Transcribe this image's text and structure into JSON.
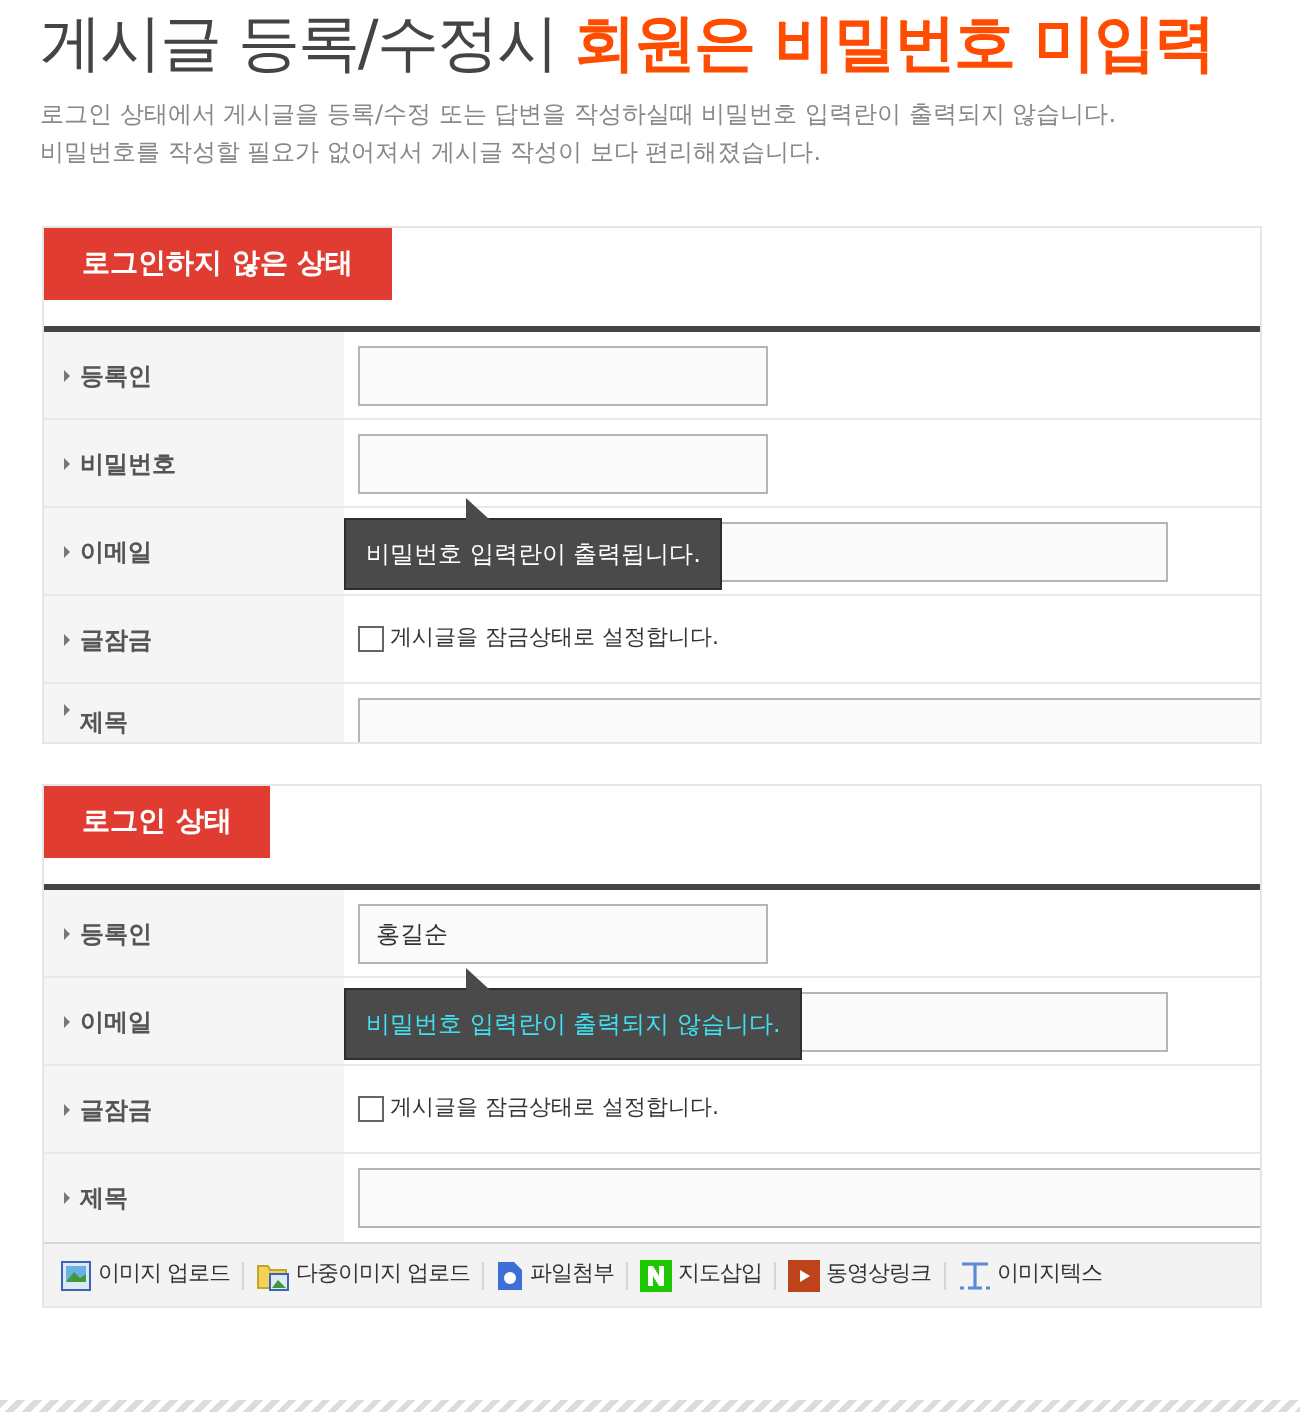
{
  "title": {
    "plain": "게시글 등록/수정시",
    "highlight": "회원은 비밀번호 미입력"
  },
  "description": [
    "로그인 상태에서 게시글을 등록/수정 또는 답변을 작성하실때 비밀번호 입력란이 출력되지 않습니다.",
    "비밀번호를 작성할 필요가 없어져서 게시글 작성이 보다 편리해졌습니다."
  ],
  "panels": [
    {
      "tab": "로그인하지 않은 상태",
      "rows": [
        {
          "kind": "short",
          "label": "등록인"
        },
        {
          "kind": "short",
          "label": "비밀번호",
          "tooltip": {
            "text": "비밀번호 입력란이 출력됩니다.",
            "color": "#ffffff"
          }
        },
        {
          "kind": "medium",
          "label": "이메일"
        },
        {
          "kind": "checkbox",
          "label": "글잠금",
          "option": "게시글을 잠금상태로 설정합니다.",
          "checked": false
        },
        {
          "kind": "wide",
          "label": "제목"
        }
      ]
    },
    {
      "tab": "로그인 상태",
      "rows": [
        {
          "kind": "short",
          "label": "등록인",
          "value": "홍길순",
          "tooltip": {
            "text": "비밀번호 입력란이 출력되지 않습니다.",
            "color": "#3fe0f0"
          }
        },
        {
          "kind": "medium",
          "label": "이메일"
        },
        {
          "kind": "checkbox",
          "label": "글잠금",
          "option": "게시글을 잠금상태로 설정합니다.",
          "checked": false
        },
        {
          "kind": "wide",
          "label": "제목"
        }
      ],
      "toolbar": [
        {
          "kind": "image",
          "label": "이미지 업로드"
        },
        {
          "kind": "multi-image",
          "label": "다중이미지 업로드"
        },
        {
          "kind": "file",
          "label": "파일첨부"
        },
        {
          "kind": "map",
          "label": "지도삽입"
        },
        {
          "kind": "video",
          "label": "동영상링크"
        },
        {
          "kind": "text-image",
          "label": "이미지텍스"
        }
      ]
    }
  ]
}
